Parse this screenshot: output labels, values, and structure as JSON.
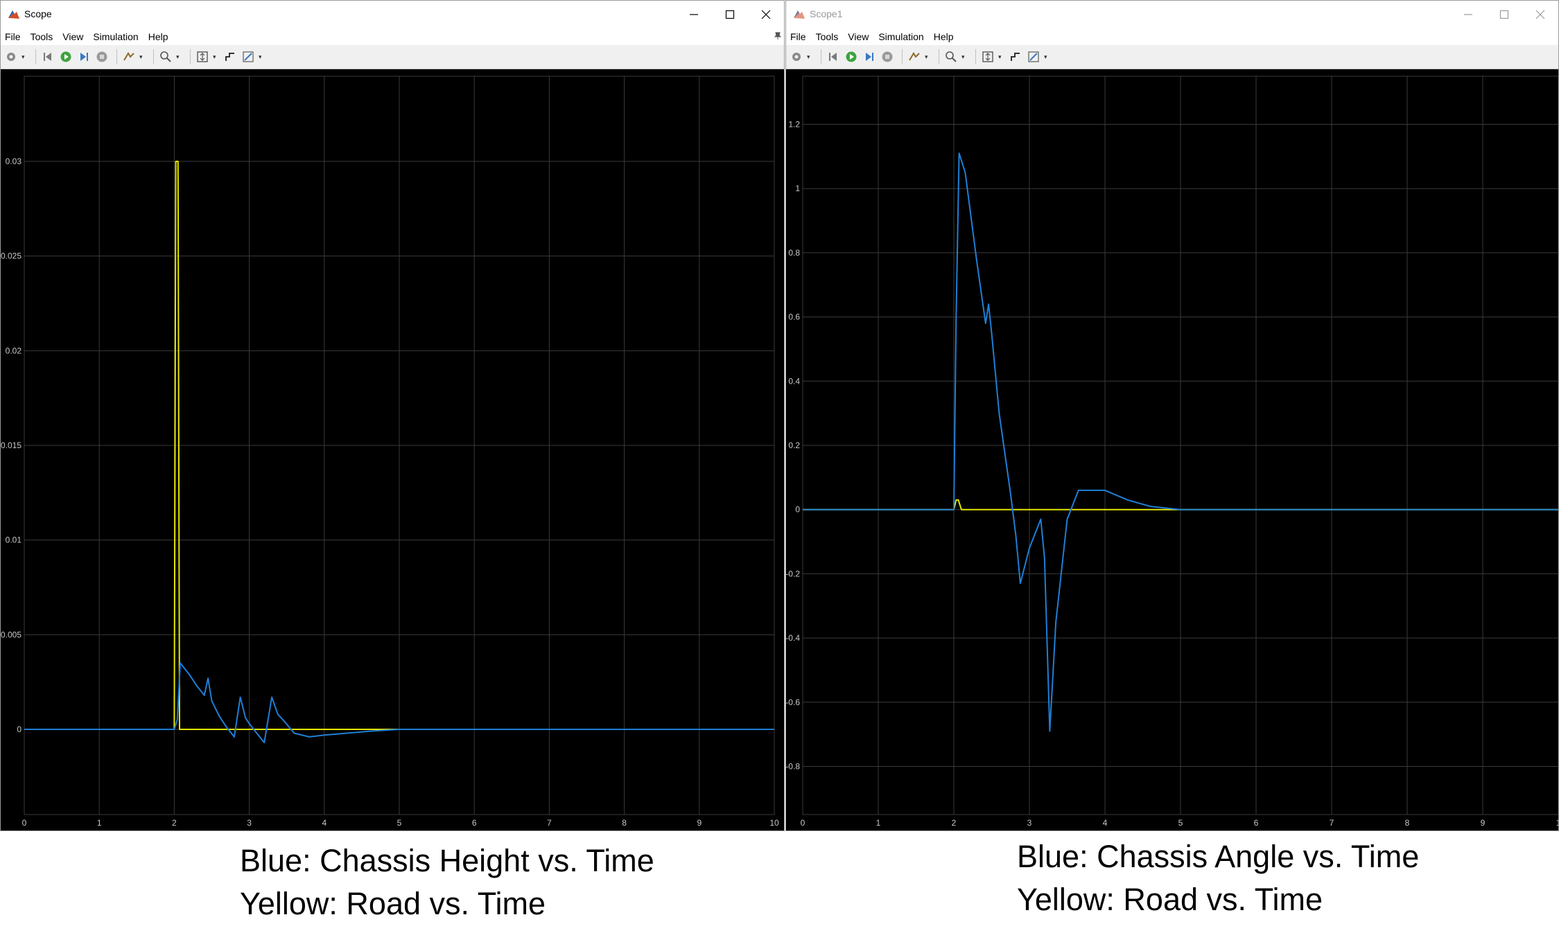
{
  "windows": [
    {
      "title": "Scope",
      "active": true,
      "menu": [
        "File",
        "Tools",
        "View",
        "Simulation",
        "Help"
      ],
      "chart_data": {
        "type": "line",
        "title": "",
        "xlabel": "",
        "ylabel": "",
        "xlim": [
          0,
          10
        ],
        "ylim": [
          -0.0045,
          0.0345
        ],
        "xticks": [
          "0",
          "1",
          "2",
          "3",
          "4",
          "5",
          "6",
          "7",
          "8",
          "9",
          "10"
        ],
        "yticks": [
          "0",
          "0.005",
          "0.01",
          "0.015",
          "0.02",
          "0.025",
          "0.03"
        ],
        "grid": true,
        "legend": "none",
        "series": [
          {
            "color": "#e6e600",
            "x": [
              0,
              2.0,
              2.02,
              2.05,
              2.07,
              10
            ],
            "y": [
              0,
              0,
              0.03,
              0.03,
              0,
              0
            ]
          },
          {
            "color": "#1f7fd6",
            "x": [
              0,
              2.0,
              2.04,
              2.08,
              2.2,
              2.3,
              2.4,
              2.45,
              2.5,
              2.6,
              2.7,
              2.8,
              2.88,
              2.95,
              3.0,
              3.1,
              3.2,
              3.3,
              3.38,
              3.45,
              3.6,
              3.8,
              4.0,
              4.3,
              4.6,
              5.0,
              10
            ],
            "y": [
              0,
              0,
              0.0005,
              0.0035,
              0.0029,
              0.0023,
              0.0018,
              0.0027,
              0.0015,
              0.0007,
              0.0001,
              -0.0004,
              0.0017,
              0.0006,
              0.0003,
              -0.0002,
              -0.0007,
              0.0017,
              0.0008,
              0.0005,
              -0.0002,
              -0.0004,
              -0.0003,
              -0.0002,
              -0.0001,
              0,
              0
            ]
          }
        ]
      }
    },
    {
      "title": "Scope1",
      "active": false,
      "menu": [
        "File",
        "Tools",
        "View",
        "Simulation",
        "Help"
      ],
      "chart_data": {
        "type": "line",
        "title": "",
        "xlabel": "",
        "ylabel": "",
        "xlim": [
          0,
          10
        ],
        "ylim": [
          -0.95,
          1.35
        ],
        "xticks": [
          "0",
          "1",
          "2",
          "3",
          "4",
          "5",
          "6",
          "7",
          "8",
          "9",
          "1"
        ],
        "yticks": [
          "-0.8",
          "-0.6",
          "-0.4",
          "-0.2",
          "0",
          "0.2",
          "0.4",
          "0.6",
          "0.8",
          "1",
          "1.2"
        ],
        "grid": true,
        "legend": "none",
        "series": [
          {
            "color": "#e6e600",
            "x": [
              0,
              2.0,
              2.03,
              2.06,
              2.1,
              10
            ],
            "y": [
              0,
              0,
              0.03,
              0.03,
              0,
              0
            ]
          },
          {
            "color": "#1f7fd6",
            "x": [
              0,
              2.0,
              2.03,
              2.07,
              2.15,
              2.3,
              2.42,
              2.46,
              2.5,
              2.6,
              2.75,
              2.82,
              2.88,
              3.0,
              3.15,
              3.2,
              3.27,
              3.35,
              3.5,
              3.65,
              3.82,
              4.0,
              4.3,
              4.6,
              5.0,
              10
            ],
            "y": [
              0,
              0,
              0.6,
              1.11,
              1.05,
              0.78,
              0.58,
              0.64,
              0.55,
              0.3,
              0.05,
              -0.08,
              -0.23,
              -0.12,
              -0.03,
              -0.15,
              -0.69,
              -0.35,
              -0.03,
              0.06,
              0.06,
              0.06,
              0.03,
              0.01,
              0,
              0
            ]
          }
        ]
      }
    }
  ],
  "captions": [
    {
      "line1": "Blue: Chassis Height vs. Time",
      "line2": "Yellow: Road vs. Time"
    },
    {
      "line1": "Blue: Chassis Angle vs. Time",
      "line2": "Yellow: Road vs. Time"
    }
  ],
  "icons": [
    "matlab-scope-icon",
    "minimize-icon",
    "maximize-icon",
    "close-icon",
    "settings-icon",
    "step-back-icon",
    "run-icon",
    "step-forward-icon",
    "stop-icon",
    "highlight-icon",
    "zoom-icon",
    "fit-axes-icon",
    "triggers-icon",
    "measurement-icon"
  ]
}
